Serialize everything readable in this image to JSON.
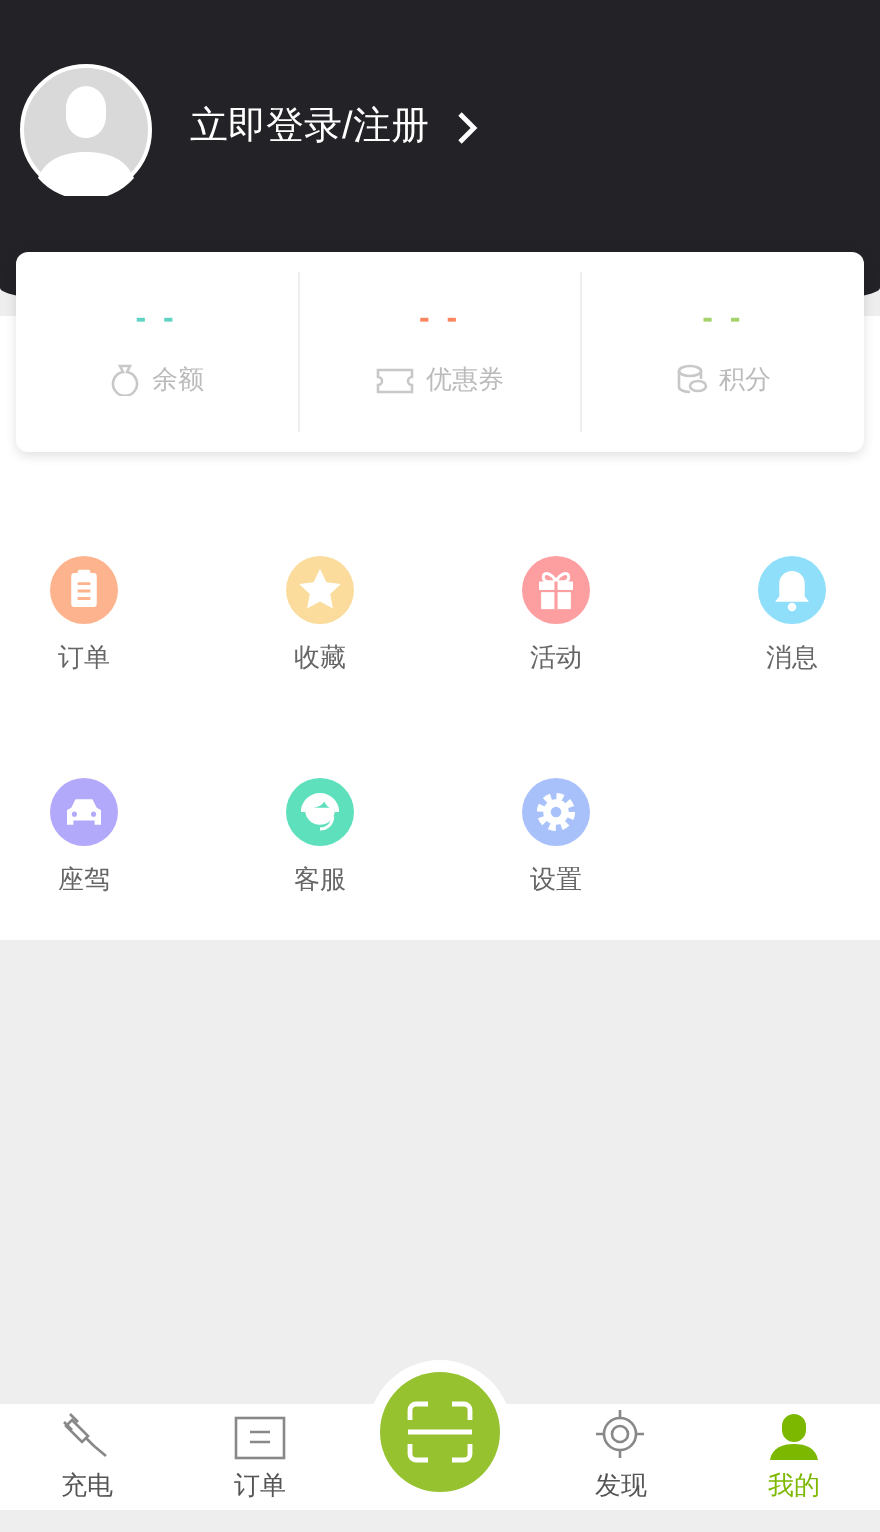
{
  "header": {
    "login_text": "立即登录/注册"
  },
  "stats": [
    {
      "value": "- -",
      "label": "余额",
      "color": "#5fd3c4"
    },
    {
      "value": "- -",
      "label": "优惠券",
      "color": "#fa8660"
    },
    {
      "value": "- -",
      "label": "积分",
      "color": "#a5d36b"
    }
  ],
  "menu": [
    {
      "label": "订单",
      "color": "#fdb48e"
    },
    {
      "label": "收藏",
      "color": "#fbdc9c"
    },
    {
      "label": "活动",
      "color": "#fd9ea1"
    },
    {
      "label": "消息",
      "color": "#8fdffb"
    },
    {
      "label": "座驾",
      "color": "#b3a9fb"
    },
    {
      "label": "客服",
      "color": "#5ee0bd"
    },
    {
      "label": "设置",
      "color": "#a9c1fb"
    }
  ],
  "tab_bar": [
    {
      "label": "充电",
      "selected": false
    },
    {
      "label": "订单",
      "selected": false
    },
    {
      "kind": "scan"
    },
    {
      "label": "发现",
      "selected": false
    },
    {
      "label": "我的",
      "selected": true
    }
  ]
}
